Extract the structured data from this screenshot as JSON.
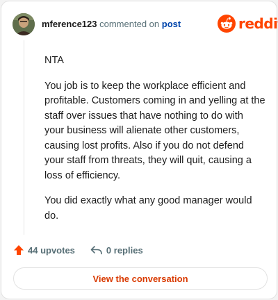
{
  "header": {
    "username": "mference123",
    "action_text": "commented on",
    "post_link": "post",
    "brand": "reddit",
    "brand_color": "#ff4500"
  },
  "comment": {
    "paragraphs": [
      "NTA",
      "You job is to keep the workplace efficient and profitable. Customers coming in and yelling at the staff over issues that have nothing to do with your business will alienate other customers, causing lost profits. Also if you do not defend your staff from threats, they will quit, causing a loss of efficiency.",
      "You did exactly what any good manager would do."
    ]
  },
  "footer": {
    "upvotes": "44 upvotes",
    "upvote_icon": "upvote-arrow-icon",
    "upvote_color": "#ff4500",
    "replies": "0 replies",
    "reply_icon": "reply-arrow-icon"
  },
  "cta": {
    "label": "View the conversation",
    "color": "#d93a00"
  }
}
